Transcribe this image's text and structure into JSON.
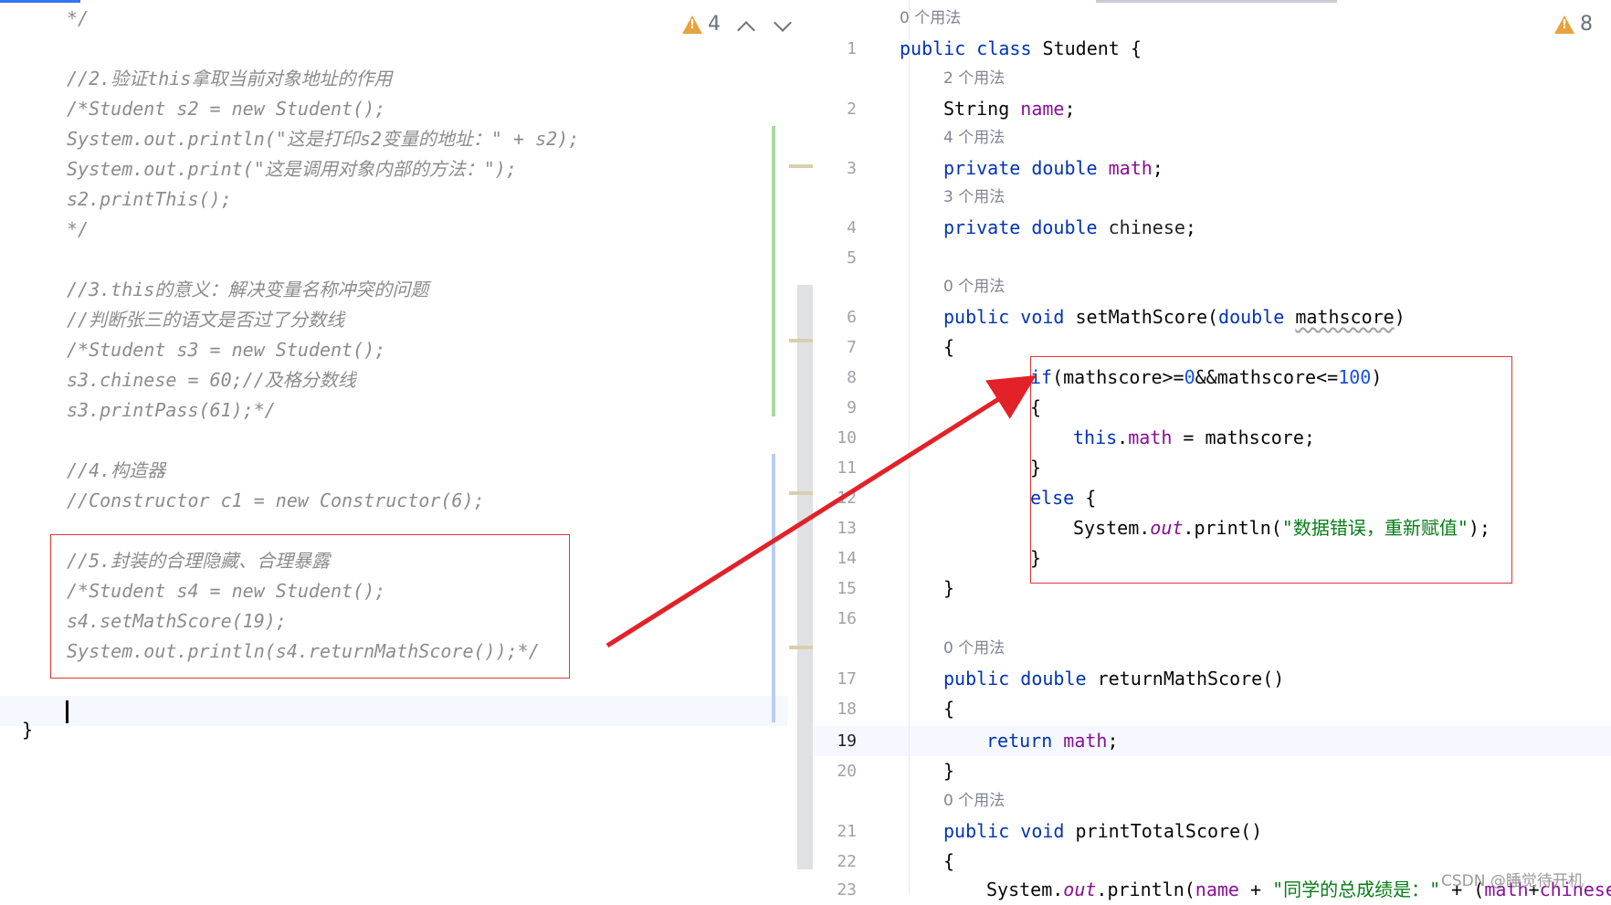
{
  "left_editor": {
    "lines": [
      "*/",
      "",
      "//2.验证this拿取当前对象地址的作用",
      "/*Student s2 = new Student();",
      "System.out.println(\"这是打印s2变量的地址：\" + s2);",
      "System.out.print(\"这是调用对象内部的方法：\");",
      "s2.printThis();",
      "*/",
      "",
      "//3.this的意义：解决变量名称冲突的问题",
      "//判断张三的语文是否过了分数线",
      "/*Student s3 = new Student();",
      "s3.chinese = 60;//及格分数线",
      "s3.printPass(61);*/",
      "",
      "//4.构造器",
      "//Constructor c1 = new Constructor(6);",
      "",
      "//5.封装的合理隐藏、合理暴露",
      "/*Student s4 = new Student();",
      "s4.setMathScore(19);",
      "System.out.println(s4.returnMathScore());*/",
      "",
      ""
    ],
    "closing_brace": "}",
    "inspection_count": "4"
  },
  "right_editor": {
    "inspection_count": "8",
    "usage_hints": {
      "h0": "0 个用法",
      "h1": "2 个用法",
      "h2": "4 个用法",
      "h3": "3 个用法",
      "h4": "0 个用法",
      "h5": "0 个用法",
      "h6": "0 个用法"
    },
    "line_numbers": [
      "1",
      "2",
      "3",
      "4",
      "5",
      "6",
      "7",
      "8",
      "9",
      "10",
      "11",
      "12",
      "13",
      "14",
      "15",
      "16",
      "17",
      "18",
      "19",
      "20",
      "21",
      "22",
      "23"
    ],
    "active_line": "19",
    "code": {
      "l1_kw": "public class",
      "l1_rest": " Student {",
      "l2_type": "String ",
      "l2_field": "name",
      "l2_end": ";",
      "l3_kw": "private double ",
      "l3_field": "math",
      "l3_end": ";",
      "l4_kw": "private double ",
      "l4_field": "chinese",
      "l4_end": ";",
      "l6_kw": "public void ",
      "l6_name": "setMathScore(",
      "l6_kw2": "double ",
      "l6_param": "mathscore",
      "l6_end": ")",
      "l7": "{",
      "l8_kw": "if",
      "l8_a": "(mathscore>=",
      "l8_n1": "0",
      "l8_b": "&&mathscore<=",
      "l8_n2": "100",
      "l8_c": ")",
      "l9": "{",
      "l10_kw": "this",
      "l10_dot": ".",
      "l10_field": "math",
      "l10_rest": " = mathscore;",
      "l11": "}",
      "l12_kw": "else",
      "l12_rest": " {",
      "l13_a": "System.",
      "l13_out": "out",
      "l13_b": ".println(",
      "l13_str": "\"数据错误，重新赋值\"",
      "l13_c": ");",
      "l14": "}",
      "l15": "}",
      "l17_kw": "public double ",
      "l17_rest": "returnMathScore()",
      "l18": "{",
      "l19_kw": "return ",
      "l19_field": "math",
      "l19_end": ";",
      "l20": "}",
      "l21_kw": "public void ",
      "l21_rest": "printTotalScore()",
      "l22": "{",
      "l23_a": "System.",
      "l23_out": "out",
      "l23_b": ".println(",
      "l23_field": "name",
      "l23_c": " + ",
      "l23_str": "\"同学的总成绩是：\"",
      "l23_d": " + (",
      "l23_e": "math",
      "l23_f": "+",
      "l23_g": "chinese"
    }
  },
  "watermark": "CSDN @睡觉待开机",
  "colors": {
    "highlight": "#e0373a",
    "arrow": "#e32128"
  }
}
